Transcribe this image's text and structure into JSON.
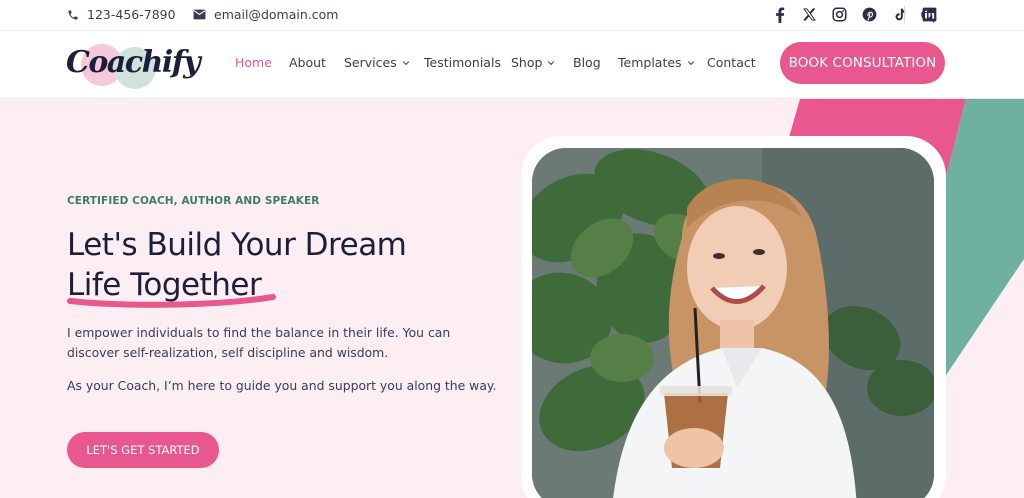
{
  "topbar": {
    "phone": "123-456-7890",
    "email": "email@domain.com",
    "socials": [
      "facebook-icon",
      "x-icon",
      "instagram-icon",
      "pinterest-icon",
      "tiktok-icon",
      "linkedin-icon"
    ]
  },
  "header": {
    "logo": "Coachify",
    "nav": [
      {
        "label": "Home",
        "active": true
      },
      {
        "label": "About"
      },
      {
        "label": "Services",
        "dropdown": true
      },
      {
        "label": "Testimonials"
      },
      {
        "label": "Shop",
        "dropdown": true
      },
      {
        "label": "Blog"
      },
      {
        "label": "Templates",
        "dropdown": true
      },
      {
        "label": "Contact"
      }
    ],
    "cta": "BOOK CONSULTATION"
  },
  "hero": {
    "eyebrow": "CERTIFIED COACH, AUTHOR AND SPEAKER",
    "headline_line1": "Let's Build Your Dream",
    "headline_line2": "Life Together",
    "paragraph1_line1": "I empower individuals to find the balance in their life. You can",
    "paragraph1_line2": "discover self-realization, self discipline and wisdom.",
    "paragraph2": "As your Coach, I’m here to guide you and support you along the way.",
    "cta": "LET'S GET STARTED"
  },
  "colors": {
    "accent": "#e8578e",
    "teal": "#6fb1a0",
    "navy": "#1c1f3b",
    "hero_bg": "#fdeef3"
  }
}
